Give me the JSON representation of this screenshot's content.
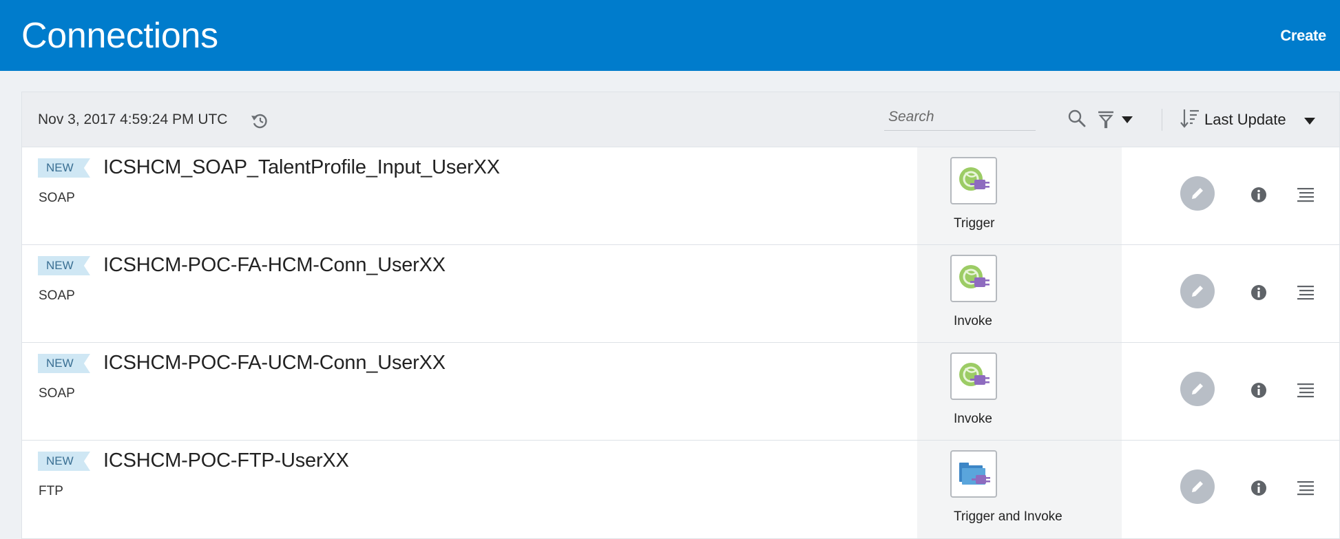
{
  "header": {
    "title": "Connections",
    "create_label": "Create"
  },
  "toolbar": {
    "timestamp": "Nov 3, 2017 4:59:24 PM UTC",
    "search_placeholder": "Search",
    "sort_label": "Last Update"
  },
  "colors": {
    "header_bg": "#007ccc",
    "badge_bg": "#cfe7f4",
    "badge_text": "#3a6f93",
    "soap_icon_green": "#9ccc65",
    "plug_purple": "#8e6bbf",
    "ftp_icon_blue": "#5aa5dc"
  },
  "connections": [
    {
      "badge": "NEW",
      "name": "ICSHCM_SOAP_TalentProfile_Input_UserXX",
      "type": "SOAP",
      "role": "Trigger",
      "icon": "soap-globe-plug-icon"
    },
    {
      "badge": "NEW",
      "name": "ICSHCM-POC-FA-HCM-Conn_UserXX",
      "type": "SOAP",
      "role": "Invoke",
      "icon": "soap-globe-plug-icon"
    },
    {
      "badge": "NEW",
      "name": "ICSHCM-POC-FA-UCM-Conn_UserXX",
      "type": "SOAP",
      "role": "Invoke",
      "icon": "soap-globe-plug-icon"
    },
    {
      "badge": "NEW",
      "name": "ICSHCM-POC-FTP-UserXX",
      "type": "FTP",
      "role": "Trigger and Invoke",
      "icon": "ftp-folder-plug-icon"
    }
  ]
}
